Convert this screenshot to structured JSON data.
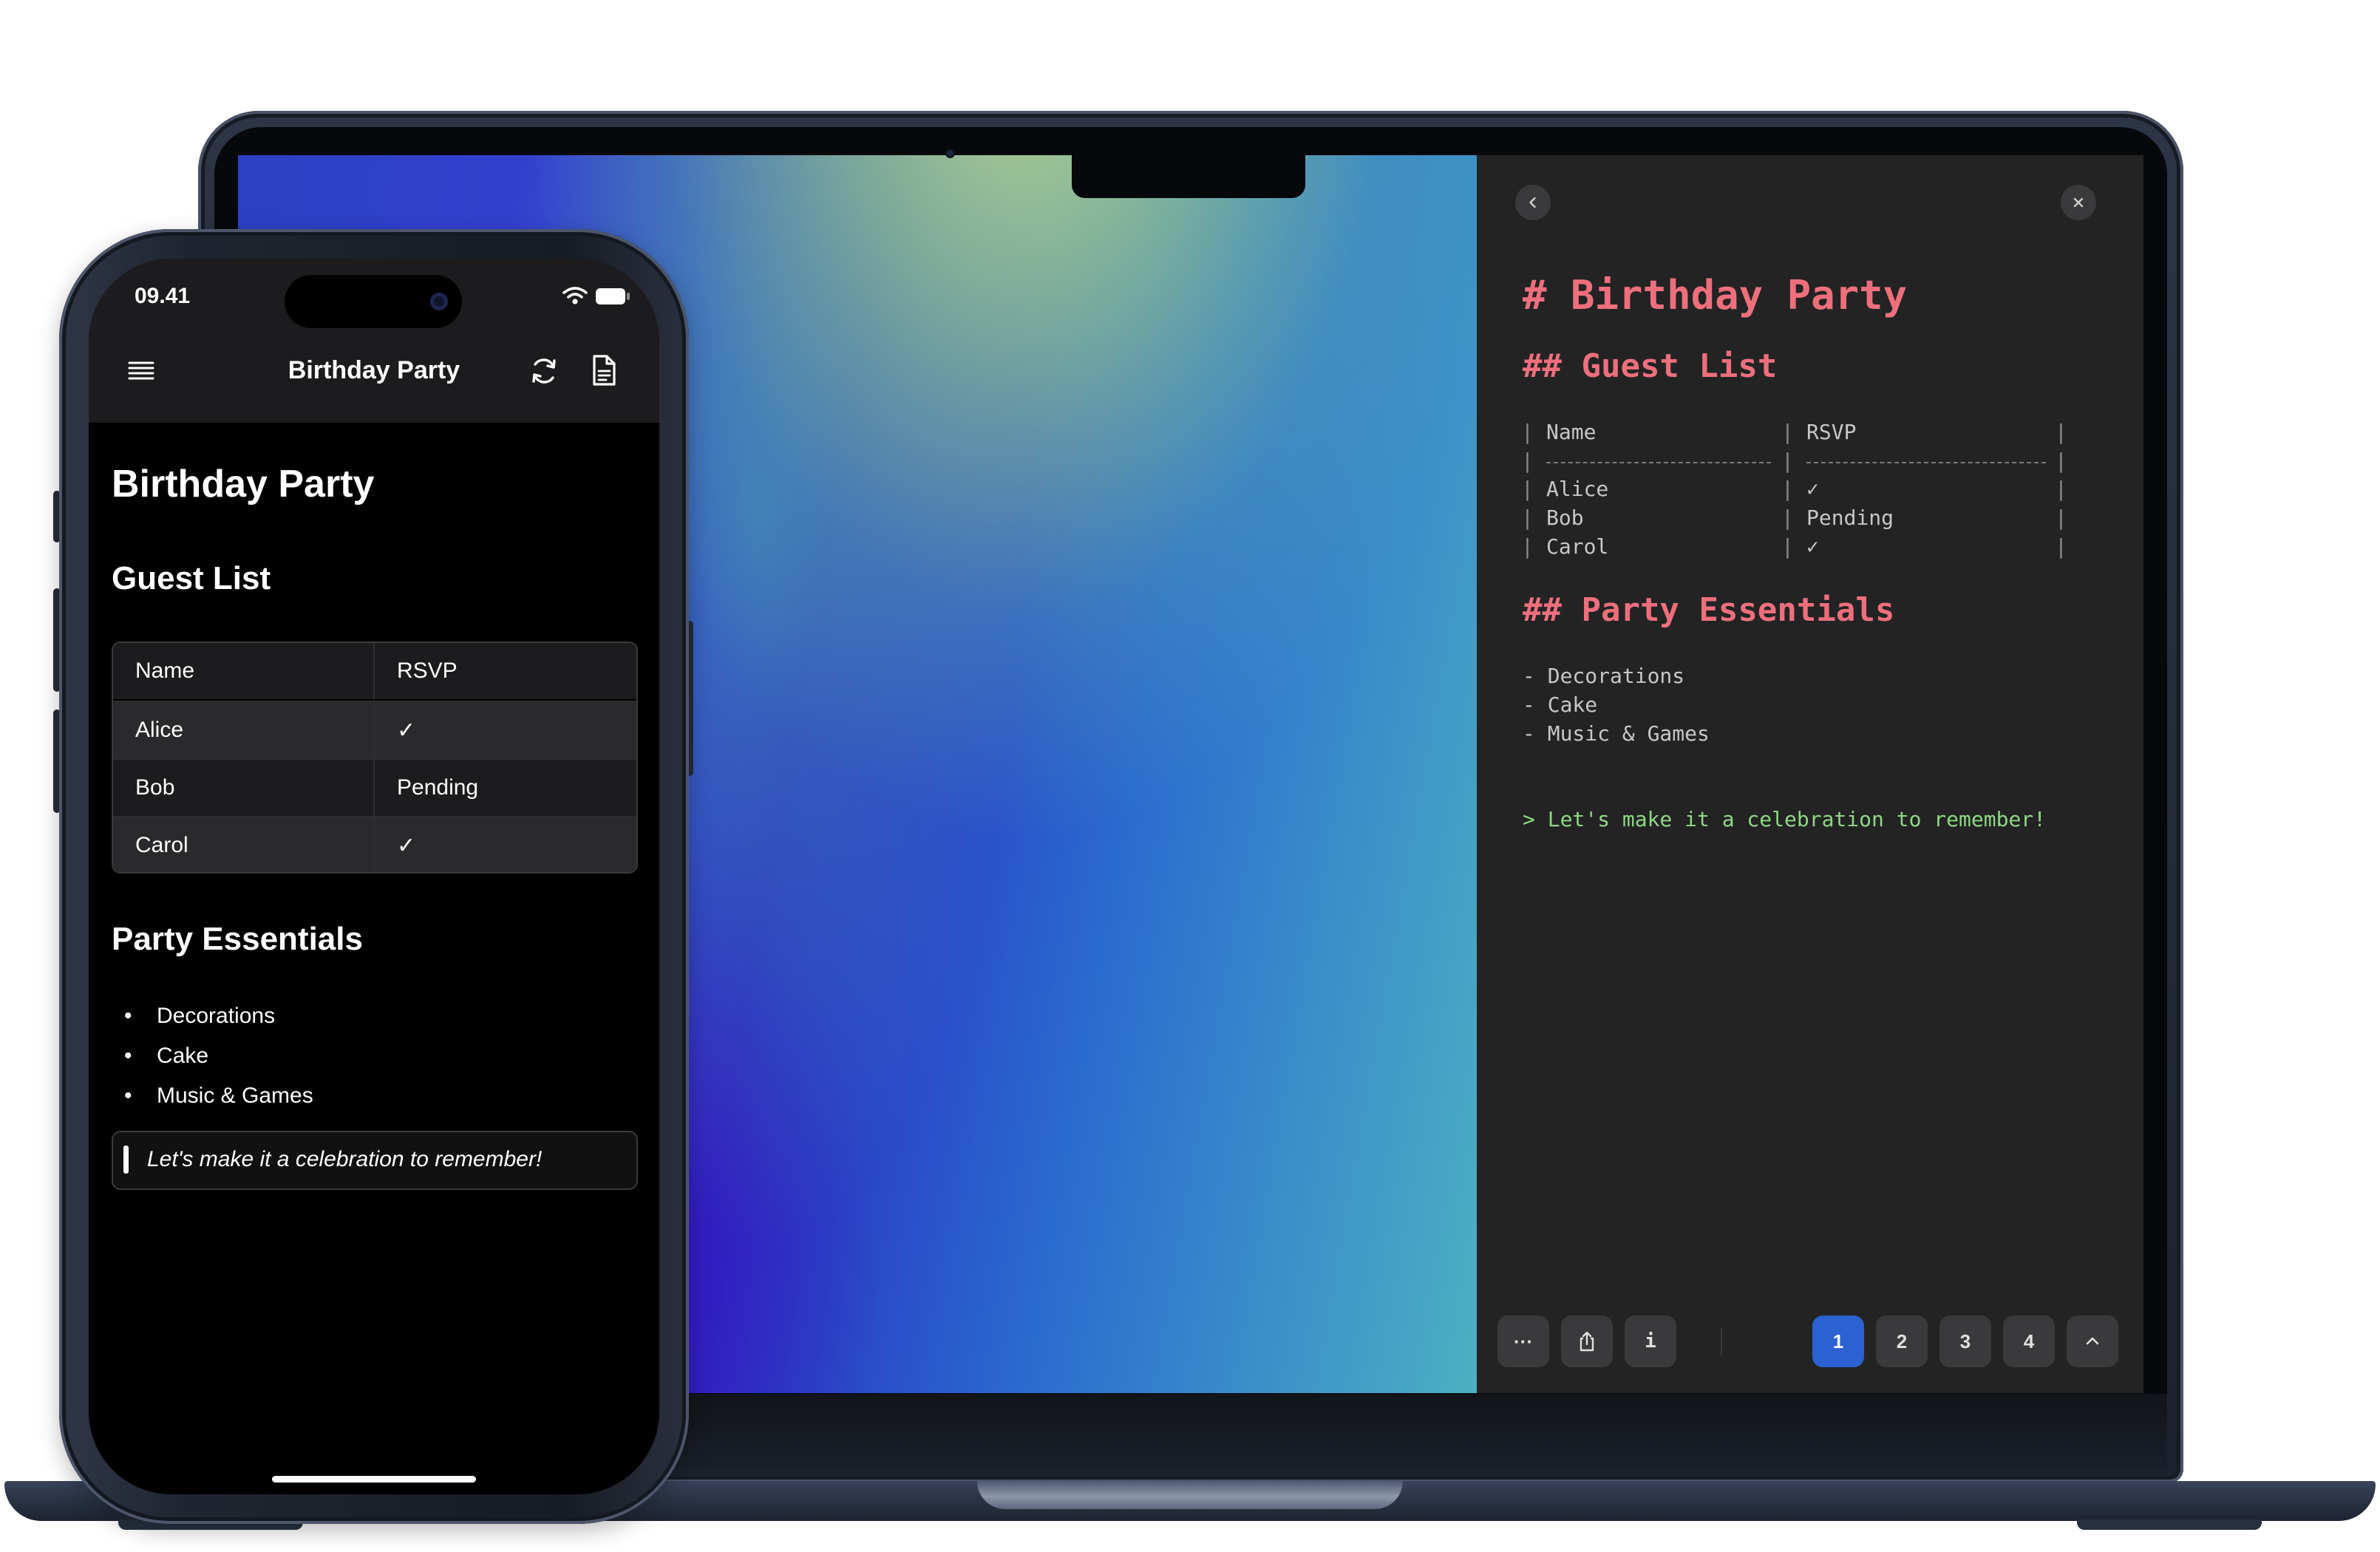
{
  "laptop": {
    "editor": {
      "lines": {
        "h1": "# Birthday Party",
        "h2_guests": "## Guest List",
        "table_header": "Name               RSVP",
        "table_sep": "----------------   ------------------",
        "row1_name": "Alice",
        "row1_rsvp": "✓",
        "row2_name": "Bob",
        "row2_rsvp": "Pending",
        "row3_name": "Carol",
        "row3_rsvp": "✓",
        "h2_essentials": "## Party Essentials",
        "item1": "- Decorations",
        "item2": "- Cake",
        "item3": "- Music & Games",
        "quote": "> Let's make it a celebration to remember!"
      },
      "table": {
        "col1_header": "Name",
        "col2_header": "RSVP"
      },
      "toolbar": {
        "more_label": "···",
        "info_label": "i",
        "pages": [
          "1",
          "2",
          "3",
          "4"
        ],
        "active_page": "1"
      },
      "icons": {
        "back": "chevron-left-icon",
        "close": "close-icon",
        "share": "share-icon",
        "collapse": "chevron-up-icon"
      }
    }
  },
  "phone": {
    "status_time": "09.41",
    "nav": {
      "title": "Birthday Party"
    },
    "content": {
      "h1": "Birthday Party",
      "h2_guests": "Guest List",
      "table_headers": [
        "Name",
        "RSVP"
      ],
      "rows": [
        {
          "name": "Alice",
          "rsvp": "✓"
        },
        {
          "name": "Bob",
          "rsvp": "Pending"
        },
        {
          "name": "Carol",
          "rsvp": "✓"
        }
      ],
      "h2_essentials": "Party Essentials",
      "items": [
        "Decorations",
        "Cake",
        "Music & Games"
      ],
      "quote": "Let's make it a celebration to remember!"
    }
  },
  "colors": {
    "heading_red": "#ee6f7c",
    "quote_green": "#8ed884",
    "active_blue": "#2b61d1",
    "editor_bg": "#232323"
  }
}
